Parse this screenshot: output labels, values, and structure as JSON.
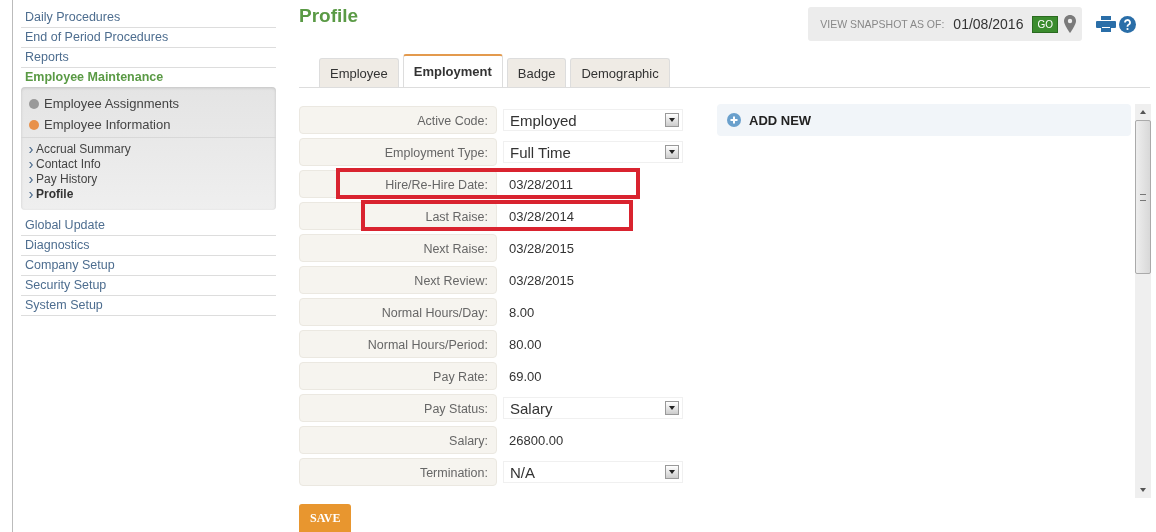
{
  "sidebar": {
    "items": [
      {
        "label": "Daily Procedures",
        "expanded": false
      },
      {
        "label": "End of Period Procedures",
        "expanded": false
      },
      {
        "label": "Reports",
        "expanded": false
      },
      {
        "label": "Employee Maintenance",
        "expanded": true,
        "children": [
          {
            "label": "Employee Assignments",
            "expanded": false
          },
          {
            "label": "Employee Information",
            "expanded": true,
            "children": [
              {
                "label": "Accrual Summary",
                "selected": false
              },
              {
                "label": "Contact Info",
                "selected": false
              },
              {
                "label": "Pay History",
                "selected": false
              },
              {
                "label": "Profile",
                "selected": true
              }
            ]
          }
        ]
      },
      {
        "label": "Global Update",
        "expanded": false
      },
      {
        "label": "Diagnostics",
        "expanded": false
      },
      {
        "label": "Company Setup",
        "expanded": false
      },
      {
        "label": "Security Setup",
        "expanded": false
      },
      {
        "label": "System Setup",
        "expanded": false
      }
    ]
  },
  "page_title": "Profile",
  "snapshot": {
    "label": "VIEW SNAPSHOT AS OF:",
    "date": "01/08/2016",
    "button": "GO"
  },
  "tabs": [
    {
      "label": "Employee",
      "selected": false
    },
    {
      "label": "Employment",
      "selected": true
    },
    {
      "label": "Badge",
      "selected": false
    },
    {
      "label": "Demographic",
      "selected": false
    }
  ],
  "fields": [
    {
      "label": "Active Code:",
      "value": "Employed",
      "kind": "select",
      "highlighted": false
    },
    {
      "label": "Employment Type:",
      "value": "Full Time",
      "kind": "select",
      "highlighted": false
    },
    {
      "label": "Hire/Re-Hire Date:",
      "value": "03/28/2011",
      "kind": "text",
      "highlighted": true
    },
    {
      "label": "Last Raise:",
      "value": "03/28/2014",
      "kind": "text",
      "highlighted": true
    },
    {
      "label": "Next Raise:",
      "value": "03/28/2015",
      "kind": "text",
      "highlighted": false
    },
    {
      "label": "Next Review:",
      "value": "03/28/2015",
      "kind": "text",
      "highlighted": false
    },
    {
      "label": "Normal Hours/Day:",
      "value": "8.00",
      "kind": "text",
      "highlighted": false
    },
    {
      "label": "Normal Hours/Period:",
      "value": "80.00",
      "kind": "text",
      "highlighted": false
    },
    {
      "label": "Pay Rate:",
      "value": "69.00",
      "kind": "text",
      "highlighted": false
    },
    {
      "label": "Pay Status:",
      "value": "Salary",
      "kind": "select",
      "highlighted": false
    },
    {
      "label": "Salary:",
      "value": "26800.00",
      "kind": "text",
      "highlighted": false
    },
    {
      "label": "Termination:",
      "value": "N/A",
      "kind": "select",
      "highlighted": false
    }
  ],
  "add_new": {
    "label": "ADD NEW"
  },
  "save_button": "SAVE"
}
